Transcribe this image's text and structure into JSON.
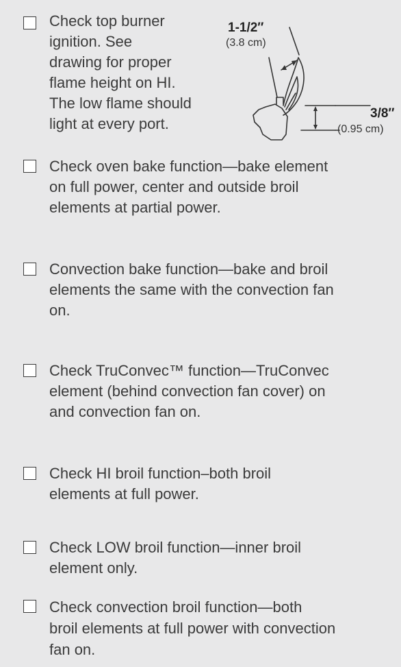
{
  "items": [
    {
      "lines": [
        "Check top burner",
        "ignition. See",
        "drawing for proper",
        "flame height on HI.",
        "The low flame should",
        "light at every port."
      ]
    },
    {
      "lines": [
        "Check oven bake function—bake element",
        "on full power, center and outside broil",
        "elements at partial power."
      ]
    },
    {
      "lines": [
        "Convection bake function—bake and broil",
        "elements the same with the convection fan",
        "on."
      ]
    },
    {
      "lines": [
        "Check TruConvec™ function—TruConvec",
        "element (behind convection fan cover) on",
        "and convection fan on."
      ]
    },
    {
      "lines": [
        "Check HI broil function–both broil",
        "elements at full power."
      ]
    },
    {
      "lines": [
        "Check LOW broil function—inner broil",
        "element only."
      ]
    },
    {
      "lines": [
        "Check convection broil function—both",
        "broil elements at full power with convection",
        "fan on."
      ]
    }
  ],
  "diagram": {
    "total_height": "1-1/2″",
    "total_height_metric": "(3.8 cm)",
    "low_height": "3/8″",
    "low_height_metric": "(0.95 cm)"
  }
}
